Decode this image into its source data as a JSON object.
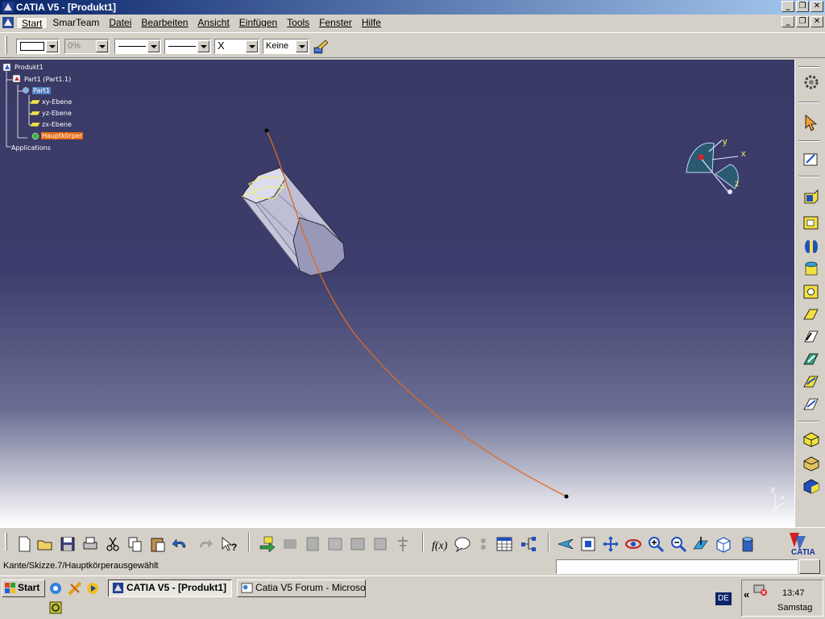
{
  "window": {
    "title": "CATIA V5 - [Produkt1]",
    "controls": [
      "_",
      "❐",
      "✕"
    ]
  },
  "menu": {
    "items": [
      {
        "label": "Start",
        "active": true
      },
      {
        "label": "SmarTeam"
      },
      {
        "label": "Datei"
      },
      {
        "label": "Bearbeiten"
      },
      {
        "label": "Ansicht"
      },
      {
        "label": "Einfügen"
      },
      {
        "label": "Tools"
      },
      {
        "label": "Fenster"
      },
      {
        "label": "Hilfe"
      }
    ]
  },
  "properties_toolbar": {
    "transparency": "0%",
    "point_symbol": "X",
    "layer": "Keine"
  },
  "tree": {
    "root": "Produkt1",
    "part_instance": "Part1 (Part1.1)",
    "part": "Part1",
    "planes": [
      "xy-Ebene",
      "yz-Ebene",
      "zx-Ebene"
    ],
    "body": "Hauptkörper",
    "applications": "Applications"
  },
  "compass": {
    "x": "x",
    "y": "y",
    "z": "z"
  },
  "axis": {
    "x": "x",
    "y": "y",
    "z": "z"
  },
  "brand": "CATIA",
  "status": {
    "message": "Kante/Skizze.7/Hauptkörperausgewählt",
    "command_input": ""
  },
  "taskbar": {
    "start": "Start",
    "tasks": [
      {
        "label": "CATIA V5 - [Produkt1]",
        "active": true
      },
      {
        "label": "Catia V5 Forum - Microso..."
      }
    ],
    "language": "DE",
    "chevron": "«",
    "time": "13:47",
    "day": "Samstag"
  },
  "colors": {
    "viewport_top": "#3a3a66",
    "viewport_bottom": "#ffffff",
    "curve": "#e06a20",
    "highlight": "#e86a10",
    "title_start": "#0a246a"
  }
}
